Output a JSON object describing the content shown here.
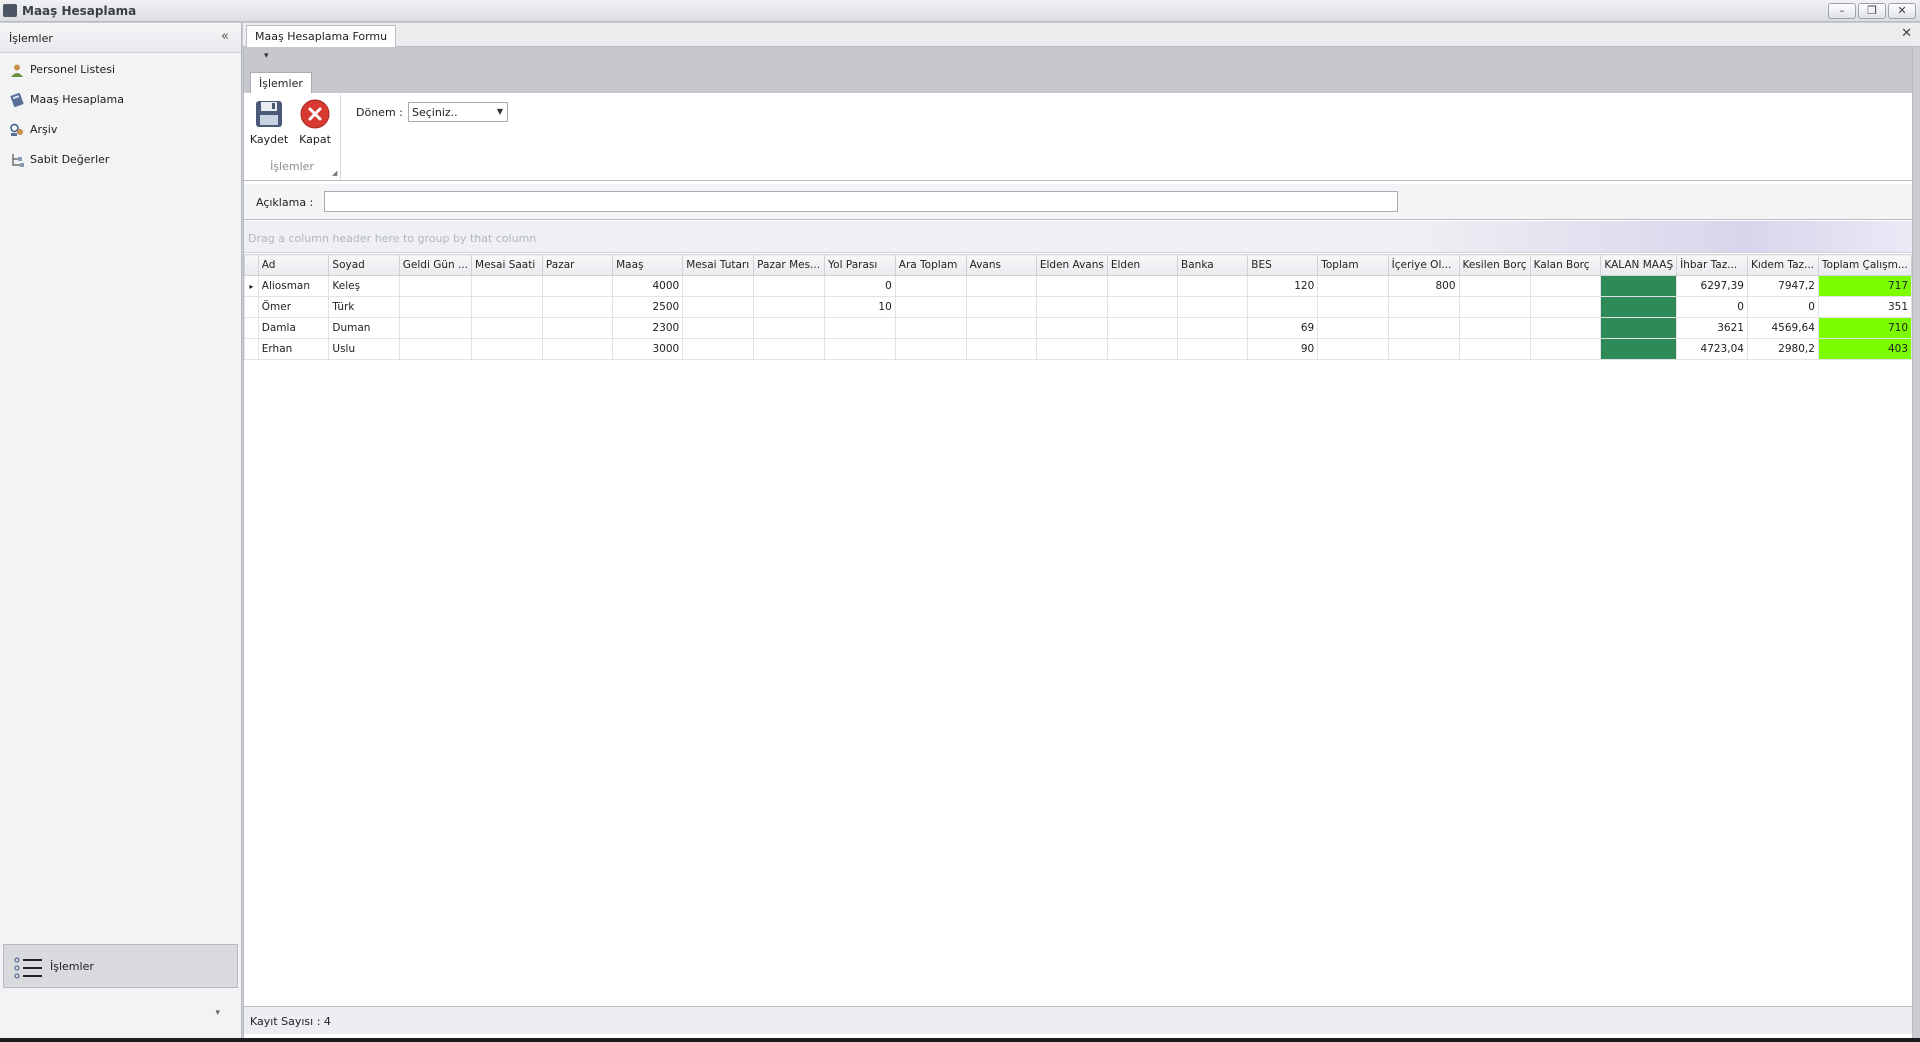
{
  "window": {
    "title": "Maaş Hesaplama",
    "minimize": "–",
    "restore": "❐",
    "close": "✕"
  },
  "sidebar": {
    "header": "İşlemler",
    "collapse_glyph": "«",
    "items": [
      {
        "label": "Personel Listesi",
        "icon": "user-icon"
      },
      {
        "label": "Maaş Hesaplama",
        "icon": "calculator-icon"
      },
      {
        "label": "Arşiv",
        "icon": "archive-icon"
      },
      {
        "label": "Sabit Değerler",
        "icon": "settings-tree-icon"
      }
    ],
    "group_button": "İşlemler",
    "more_glyph": "▾"
  },
  "document": {
    "tab": "Maaş Hesaplama Formu",
    "close_glyph": "✕"
  },
  "ribbon": {
    "qat_glyph": "▾",
    "tab": "İşlemler",
    "buttons": {
      "save": "Kaydet",
      "close": "Kapat"
    },
    "group_label": "İşlemler",
    "period_label": "Dönem :",
    "period_value": "Seçiniz..",
    "period_dropdown": "▼"
  },
  "description": {
    "label": "Açıklama :",
    "value": ""
  },
  "grid": {
    "group_hint": "Drag a column header here to group by that column",
    "columns": [
      "Ad",
      "Soyad",
      "Geldi Gün ...",
      "Mesai Saati",
      "Pazar",
      "Maaş",
      "Mesai Tutarı",
      "Pazar Mes...",
      "Yol Parası",
      "Ara Toplam",
      "Avans",
      "Elden Avans",
      "Elden",
      "Banka",
      "BES",
      "Toplam",
      "İçeriye Ol...",
      "Kesilen Borç",
      "Kalan Borç",
      "KALAN MAAŞ",
      "İhbar Taz...",
      "Kıdem Taz...",
      "Toplam Çalışm..."
    ],
    "rows": [
      {
        "indicator": "▸",
        "cells": [
          "Aliosman",
          "Keleş",
          "",
          "",
          "",
          "4000",
          "",
          "",
          "0",
          "",
          "",
          "",
          "",
          "",
          "120",
          "",
          "800",
          "",
          "",
          "",
          "6297,39",
          "7947,2",
          "717"
        ]
      },
      {
        "indicator": "",
        "cells": [
          "Ömer",
          "Türk",
          "",
          "",
          "",
          "2500",
          "",
          "",
          "10",
          "",
          "",
          "",
          "",
          "",
          "",
          "",
          "",
          "",
          "",
          "",
          "0",
          "0",
          "351"
        ]
      },
      {
        "indicator": "",
        "cells": [
          "Damla",
          "Duman",
          "",
          "",
          "",
          "2300",
          "",
          "",
          "",
          "",
          "",
          "",
          "",
          "",
          "69",
          "",
          "",
          "",
          "",
          "",
          "3621",
          "4569,64",
          "710"
        ]
      },
      {
        "indicator": "",
        "cells": [
          "Erhan",
          "Uslu",
          "",
          "",
          "",
          "3000",
          "",
          "",
          "",
          "",
          "",
          "",
          "",
          "",
          "90",
          "",
          "",
          "",
          "",
          "",
          "4723,04",
          "2980,2",
          "403"
        ]
      }
    ],
    "highlight": {
      "kalan_color": "#2e8b57",
      "total_green_rows": [
        0,
        2,
        3
      ],
      "green_color": "#7cfc00"
    }
  },
  "status": {
    "record_count": "Kayıt Sayısı : 4"
  }
}
